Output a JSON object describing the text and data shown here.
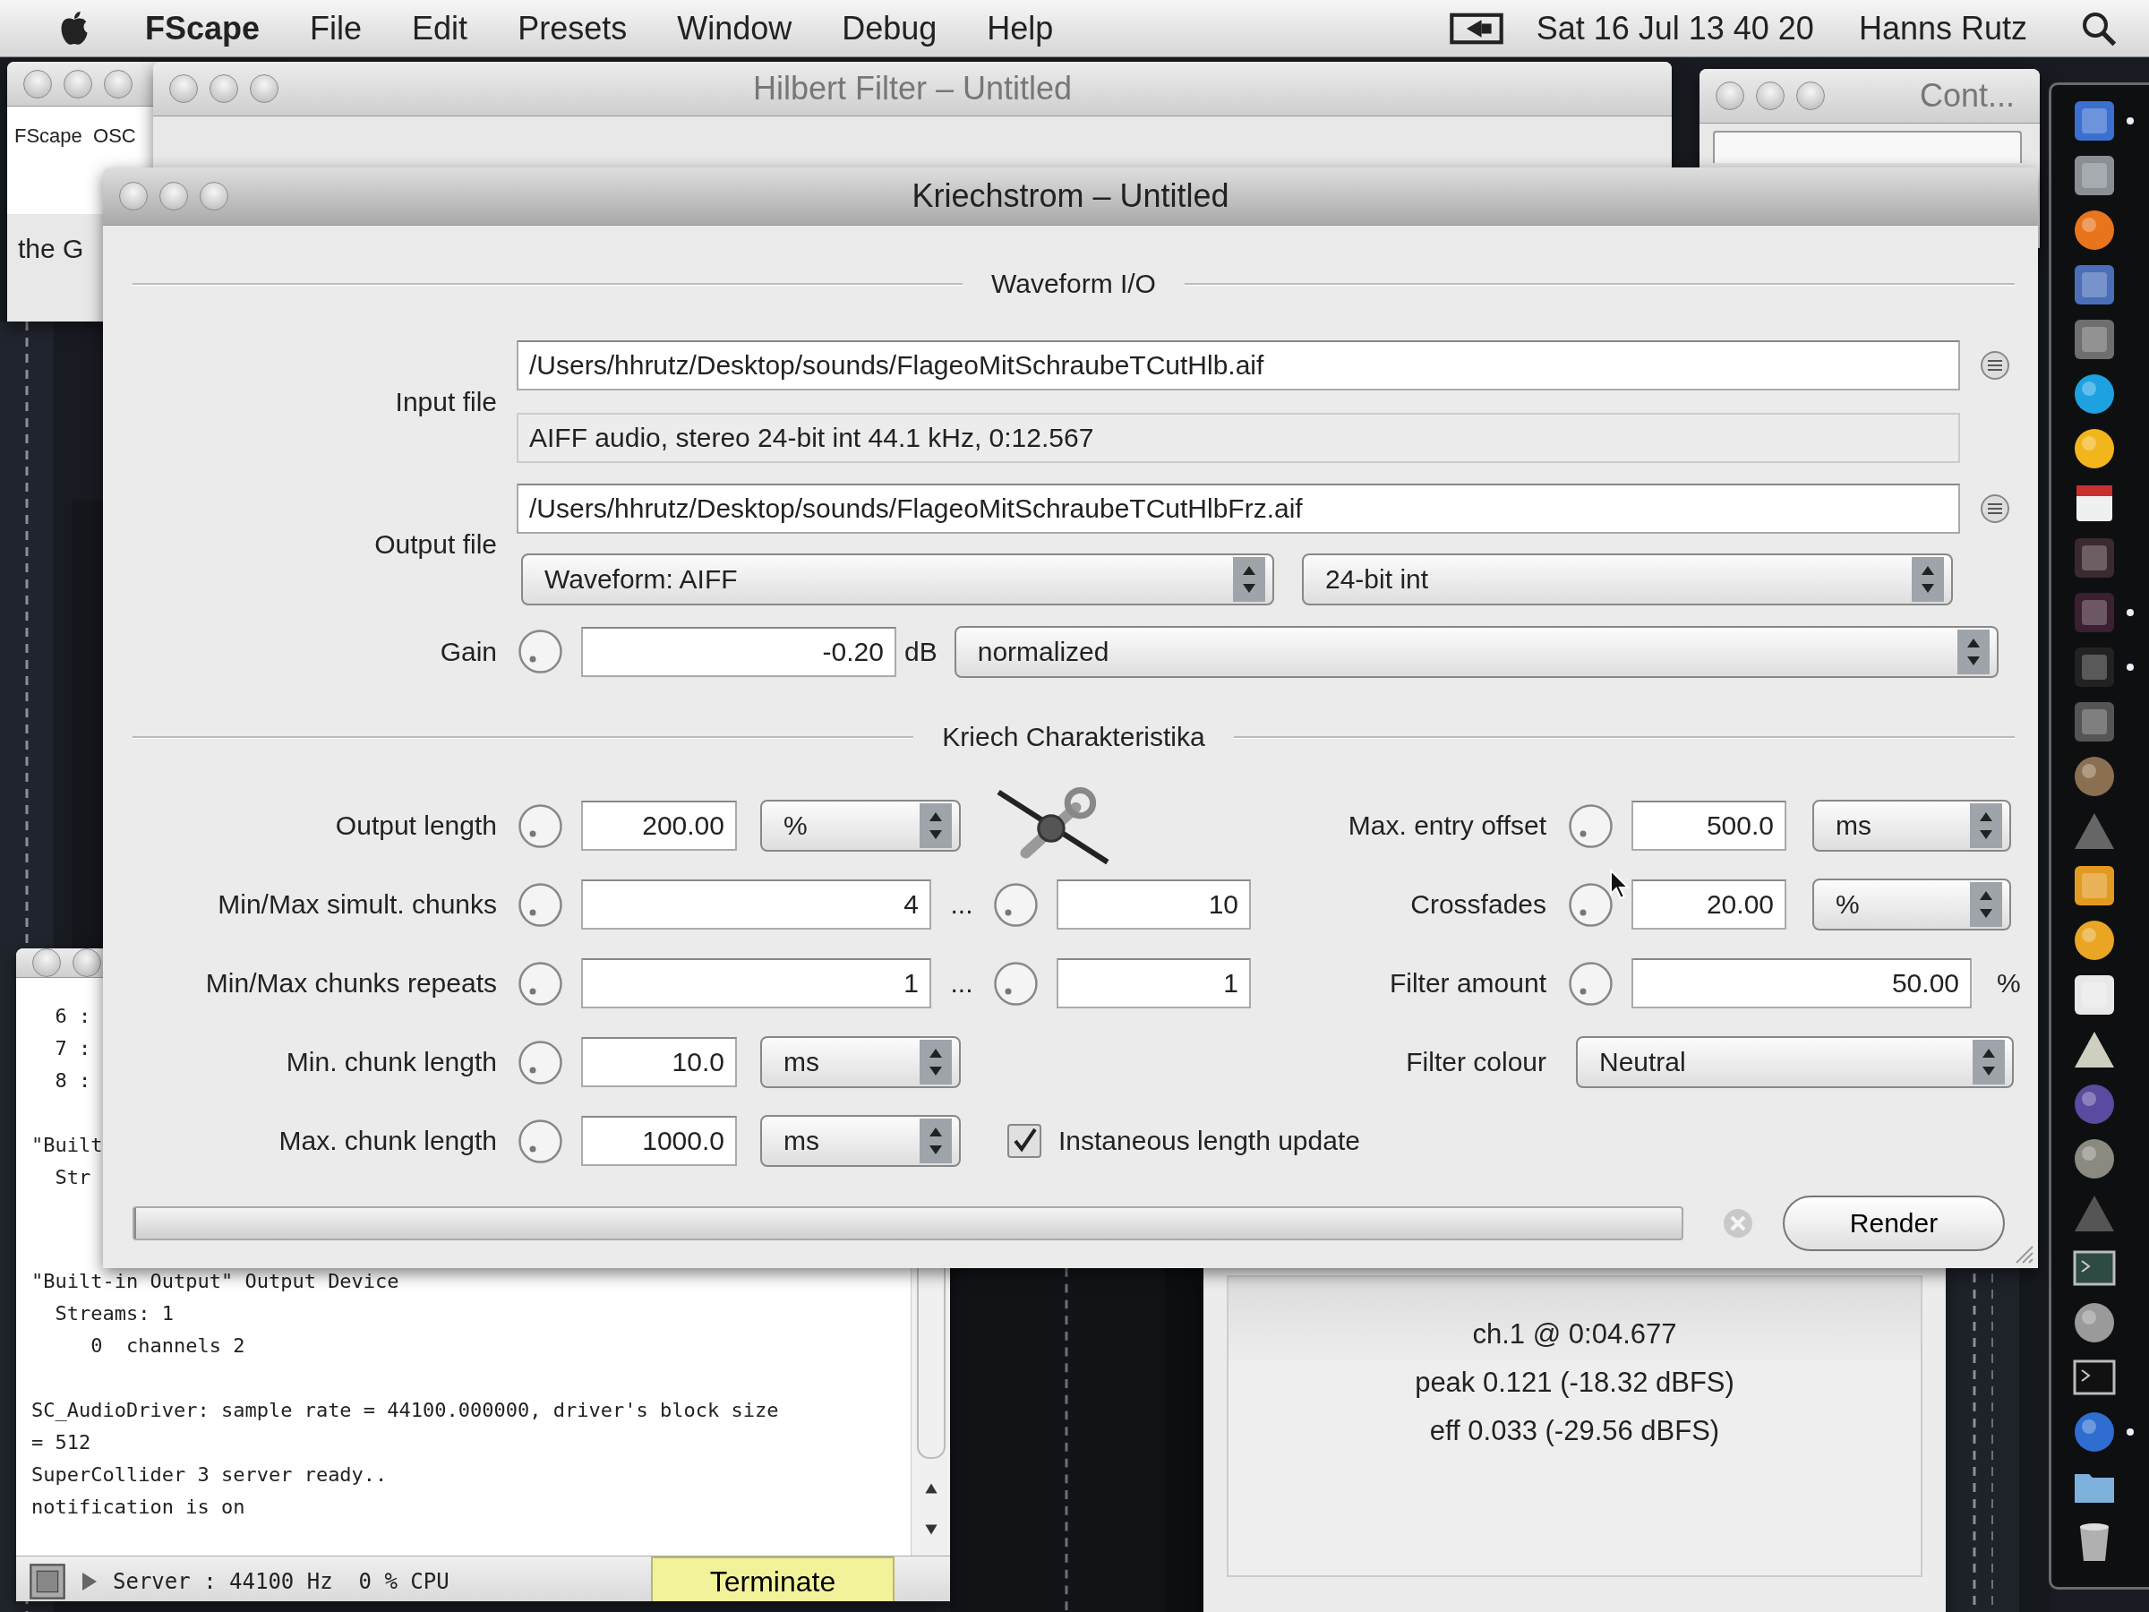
{
  "menu_bar": {
    "app_name": "FScape",
    "menus": [
      "File",
      "Edit",
      "Presets",
      "Window",
      "Debug",
      "Help"
    ],
    "clock": "Sat 16 Jul  13 40 20",
    "user": "Hanns Rutz"
  },
  "osc_window": {
    "header": "FScape  OSC",
    "footer": "the G"
  },
  "hilbert_window": {
    "title": "Hilbert Filter – Untitled"
  },
  "control_window": {
    "title": "Cont..."
  },
  "console_window": {
    "blocks": [
      [
        "  6 :",
        "  7 :",
        "  8 :"
      ],
      [
        "\"Built",
        "  Str"
      ],
      [
        "\"Built-in Output\" Output Device",
        "  Streams: 1",
        "     0  channels 2"
      ],
      [
        "SC_AudioDriver: sample rate = 44100.000000, driver's block size",
        "= 512",
        "SuperCollider 3 server ready..",
        "notification is on"
      ]
    ],
    "status": "Server : 44100 Hz  0 % CPU",
    "terminate_button": "Terminate"
  },
  "meter_window": {
    "lines": [
      "ch.1 @ 0:04.677",
      "peak 0.121 (-18.32 dBFS)",
      "eff 0.033 (-29.56 dBFS)"
    ]
  },
  "main_window": {
    "title": "Kriechstrom – Untitled",
    "io_section": {
      "title": "Waveform I/O",
      "input_label": "Input file",
      "input_path": "/Users/hhrutz/Desktop/sounds/FlageoMitSchraubeTCutHlb.aif",
      "input_info": "AIFF audio, stereo 24-bit int 44.1 kHz, 0:12.567",
      "output_label": "Output file",
      "output_path": "/Users/hhrutz/Desktop/sounds/FlageoMitSchraubeTCutHlbFrz.aif",
      "format": "Waveform: AIFF",
      "resolution": "24-bit int",
      "gain_label": "Gain",
      "gain_value": "-0.20",
      "gain_unit": "dB",
      "gain_mode": "normalized"
    },
    "kriech_section": {
      "title": "Kriech Charakteristika",
      "left_rows": [
        {
          "kind": "value_unit",
          "label": "Output length",
          "value": "200.00",
          "unit": "%"
        },
        {
          "kind": "range",
          "label": "Min/Max simult. chunks",
          "min": "4",
          "separator": "...",
          "max": "10"
        },
        {
          "kind": "range",
          "label": "Min/Max chunks repeats",
          "min": "1",
          "separator": "...",
          "max": "1"
        },
        {
          "kind": "value_unit",
          "label": "Min. chunk length",
          "value": "10.0",
          "unit": "ms"
        },
        {
          "kind": "value_unit",
          "label": "Max. chunk length",
          "value": "1000.0",
          "unit": "ms"
        }
      ],
      "right_rows": [
        {
          "kind": "value_unit",
          "label": "Max. entry offset",
          "value": "500.0",
          "unit": "ms"
        },
        {
          "kind": "value_unit",
          "label": "Crossfades",
          "value": "20.00",
          "unit": "%"
        },
        {
          "kind": "value_suffix",
          "label": "Filter amount",
          "value": "50.00",
          "suffix": "%"
        },
        {
          "kind": "choice",
          "label": "Filter colour",
          "value": "Neutral"
        }
      ],
      "option": {
        "label": "Instaneous length update",
        "checked": true
      }
    },
    "progress": {
      "level": 0
    },
    "render_button": "Render"
  },
  "dock": {
    "items": [
      {
        "running": true
      },
      {
        "running": false
      },
      {
        "running": false
      },
      {
        "running": false
      },
      {
        "running": false
      },
      {
        "running": false
      },
      {
        "running": false
      },
      {
        "running": false
      },
      {
        "running": false
      },
      {
        "running": true
      },
      {
        "running": true
      },
      {
        "running": false
      },
      {
        "running": false
      },
      {
        "running": false
      },
      {
        "running": false
      },
      {
        "running": false
      },
      {
        "running": false
      },
      {
        "running": false
      },
      {
        "running": false
      },
      {
        "running": false
      },
      {
        "running": false
      },
      {
        "running": false
      },
      {
        "running": false
      },
      {
        "running": false
      },
      {
        "running": true
      },
      {
        "running": false
      },
      {
        "running": false
      }
    ]
  }
}
